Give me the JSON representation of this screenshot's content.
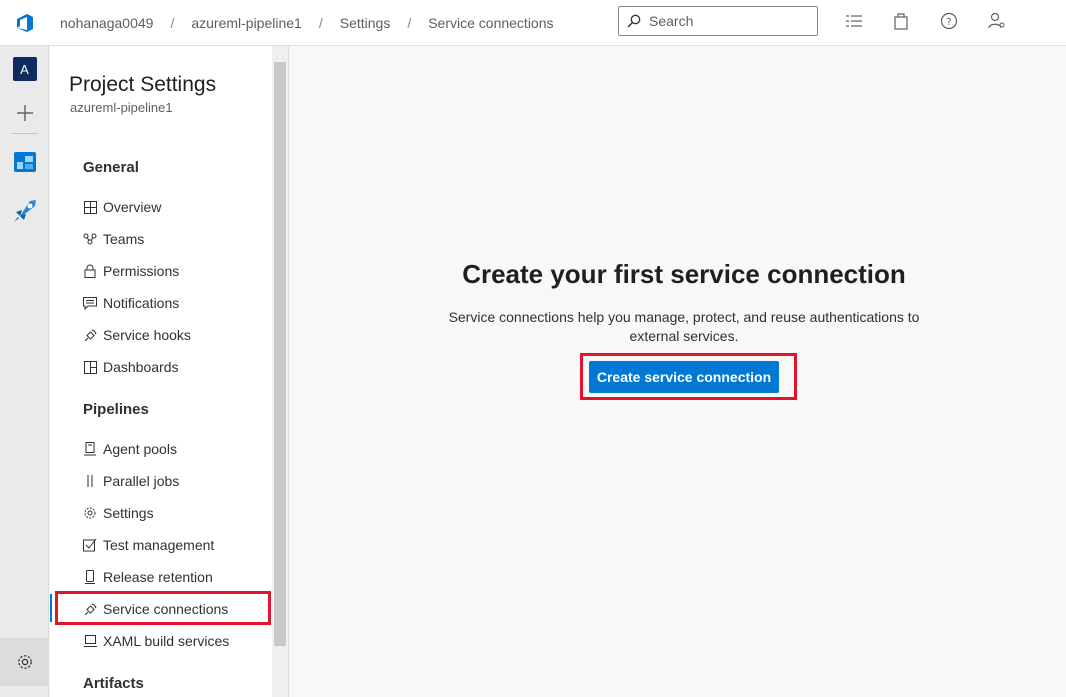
{
  "breadcrumb": [
    "nohanaga0049",
    "azureml-pipeline1",
    "Settings",
    "Service connections"
  ],
  "search": {
    "placeholder": "Search"
  },
  "rail": {
    "avatar_letter": "A"
  },
  "settings_nav": {
    "title": "Project Settings",
    "project": "azureml-pipeline1",
    "sections": [
      {
        "heading": "General",
        "items": [
          {
            "label": "Overview",
            "icon": "overview-icon"
          },
          {
            "label": "Teams",
            "icon": "teams-icon"
          },
          {
            "label": "Permissions",
            "icon": "lock-icon"
          },
          {
            "label": "Notifications",
            "icon": "notification-icon"
          },
          {
            "label": "Service hooks",
            "icon": "plug-icon"
          },
          {
            "label": "Dashboards",
            "icon": "dashboard-icon"
          }
        ]
      },
      {
        "heading": "Pipelines",
        "items": [
          {
            "label": "Agent pools",
            "icon": "agent-pool-icon"
          },
          {
            "label": "Parallel jobs",
            "icon": "parallel-icon"
          },
          {
            "label": "Settings",
            "icon": "gear-icon"
          },
          {
            "label": "Test management",
            "icon": "test-icon"
          },
          {
            "label": "Release retention",
            "icon": "phone-icon"
          },
          {
            "label": "Service connections",
            "icon": "plug-icon"
          },
          {
            "label": "XAML build services",
            "icon": "build-icon"
          }
        ]
      },
      {
        "heading": "Artifacts",
        "items": []
      }
    ],
    "active_item": "Service connections"
  },
  "main": {
    "title": "Create your first service connection",
    "description": "Service connections help you manage, protect, and reuse authentications to external services.",
    "cta_label": "Create service connection"
  },
  "colors": {
    "accent": "#0078d4",
    "highlight": "#e3132b",
    "rail": "#eaeaea"
  }
}
